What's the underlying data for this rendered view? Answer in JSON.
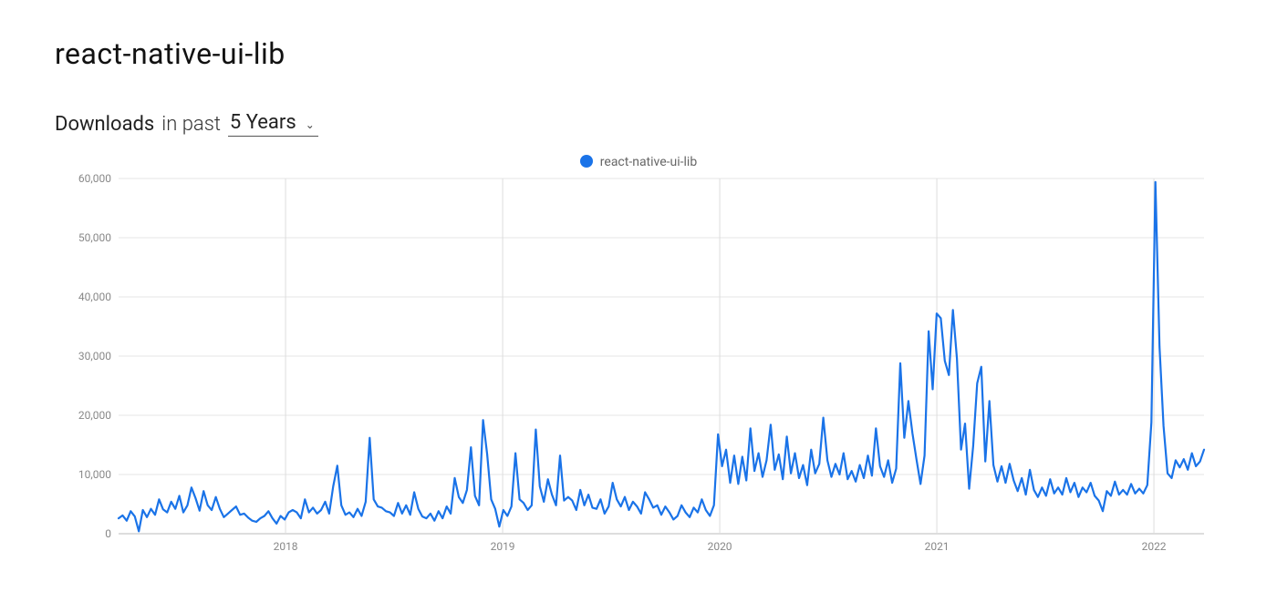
{
  "header": {
    "title": "react-native-ui-lib",
    "subtitle_prefix": "Downloads",
    "subtitle_middle": "in past",
    "range_selected": "5 Years"
  },
  "legend": {
    "series_name": "react-native-ui-lib",
    "color": "#1a73e8"
  },
  "chart_data": {
    "type": "line",
    "title": "",
    "xlabel": "",
    "ylabel": "",
    "ylim": [
      0,
      60000
    ],
    "y_ticks": [
      0,
      10000,
      20000,
      30000,
      40000,
      50000,
      60000
    ],
    "y_tick_labels": [
      "0",
      "10,000",
      "20,000",
      "30,000",
      "40,000",
      "50,000",
      "60,000"
    ],
    "x_major_labels": [
      "2018",
      "2019",
      "2020",
      "2021",
      "2022"
    ],
    "x_major_index": [
      40,
      92,
      144,
      196,
      248
    ],
    "x_index_range": [
      0,
      260
    ],
    "series": [
      {
        "name": "react-native-ui-lib",
        "color": "#1a73e8",
        "values": [
          2600,
          3100,
          2200,
          3800,
          2900,
          400,
          4000,
          2800,
          4200,
          3200,
          5800,
          4100,
          3600,
          5400,
          4200,
          6400,
          3600,
          4800,
          7800,
          6000,
          3900,
          7200,
          4800,
          4000,
          6200,
          4200,
          2800,
          3400,
          4000,
          4600,
          3200,
          3400,
          2700,
          2200,
          2000,
          2600,
          3000,
          3800,
          2600,
          1700,
          3000,
          2400,
          3600,
          4000,
          3600,
          2600,
          5800,
          3600,
          4400,
          3400,
          4000,
          5400,
          3400,
          8000,
          11500,
          4800,
          3200,
          3600,
          2800,
          4200,
          3000,
          5400,
          16200,
          5800,
          4600,
          4400,
          3800,
          3600,
          3000,
          5200,
          3400,
          4800,
          3200,
          7000,
          4200,
          2900,
          2600,
          3400,
          2200,
          3800,
          2600,
          4600,
          3400,
          9400,
          6200,
          5200,
          7400,
          14600,
          6400,
          4800,
          19200,
          13400,
          5800,
          4200,
          1200,
          4000,
          3000,
          4600,
          13600,
          5800,
          5200,
          4000,
          4800,
          17600,
          8000,
          5400,
          9200,
          6600,
          4800,
          13200,
          5600,
          6200,
          5600,
          4000,
          7400,
          4800,
          6600,
          4400,
          4200,
          5800,
          3400,
          4600,
          8600,
          5800,
          4600,
          6200,
          4000,
          5400,
          4600,
          3400,
          7000,
          5800,
          4400,
          4800,
          3200,
          4600,
          3600,
          2400,
          3000,
          4800,
          3600,
          2800,
          4400,
          3600,
          5800,
          4000,
          3000,
          4800,
          16800,
          11400,
          14200,
          8600,
          13200,
          8400,
          13000,
          9000,
          17800,
          10600,
          13600,
          9600,
          12400,
          18400,
          10800,
          13400,
          9200,
          16400,
          10200,
          13600,
          9400,
          11600,
          8200,
          14200,
          10200,
          11800,
          19600,
          12400,
          9600,
          11800,
          10000,
          13600,
          9200,
          10600,
          8800,
          11600,
          9400,
          13200,
          9800,
          17800,
          11400,
          9600,
          12400,
          8600,
          11000,
          28800,
          16200,
          22400,
          17000,
          12600,
          8400,
          13200,
          34200,
          24400,
          37200,
          36400,
          29200,
          26800,
          37800,
          29600,
          14200,
          18600,
          7600,
          14800,
          25400,
          28200,
          12200,
          22400,
          11600,
          8800,
          11400,
          8600,
          11800,
          9000,
          7200,
          9400,
          6600,
          10800,
          7400,
          6200,
          7800,
          6400,
          9200,
          6800,
          7800,
          6600,
          9400,
          7000,
          8600,
          6200,
          7800,
          7000,
          8600,
          6400,
          5600,
          3800,
          7200,
          6400,
          8800,
          6600,
          7400,
          6600,
          8400,
          6800,
          7600,
          6800,
          8200,
          18800,
          59400,
          31600,
          18200,
          10200,
          9400,
          12400,
          11200,
          12600,
          10800,
          13600,
          11400,
          12200,
          14200
        ]
      }
    ]
  }
}
